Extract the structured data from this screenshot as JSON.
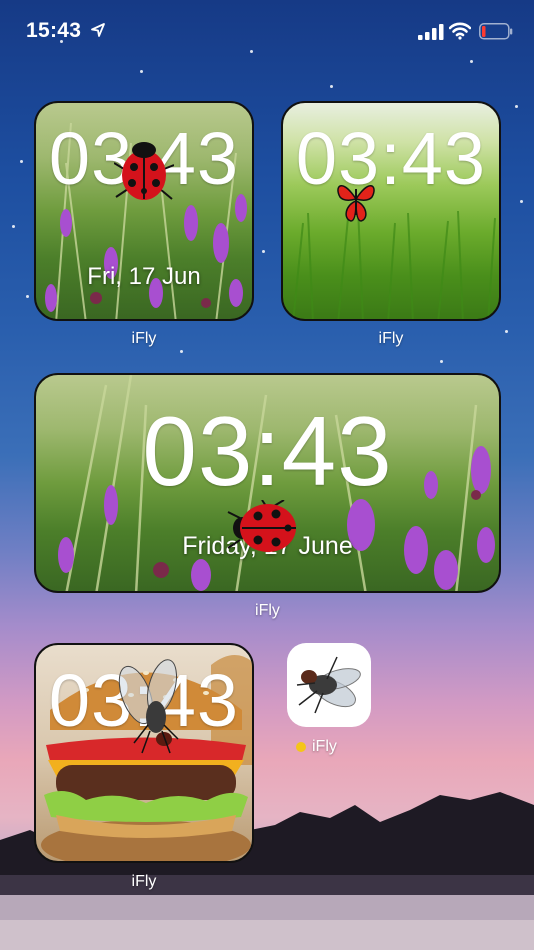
{
  "status_bar": {
    "time": "15:43",
    "location_icon": "location-arrow-icon",
    "signal_icon": "cellular-signal-icon",
    "wifi_icon": "wifi-icon",
    "battery_icon": "battery-low-icon",
    "battery_color": "#ff3b30"
  },
  "widgets": {
    "small_ladybug": {
      "clock": "03:43",
      "date": "Fri, 17 Jun",
      "label": "iFly"
    },
    "small_butterfly": {
      "clock": "03:43",
      "label": "iFly"
    },
    "medium_meadow": {
      "clock": "03:43",
      "date": "Friday, 17 June",
      "label": "iFly"
    },
    "small_burger": {
      "clock": "03:43",
      "label": "iFly"
    }
  },
  "app": {
    "label": "iFly",
    "icon": "fly-icon",
    "dot_color": "#f5c518"
  }
}
